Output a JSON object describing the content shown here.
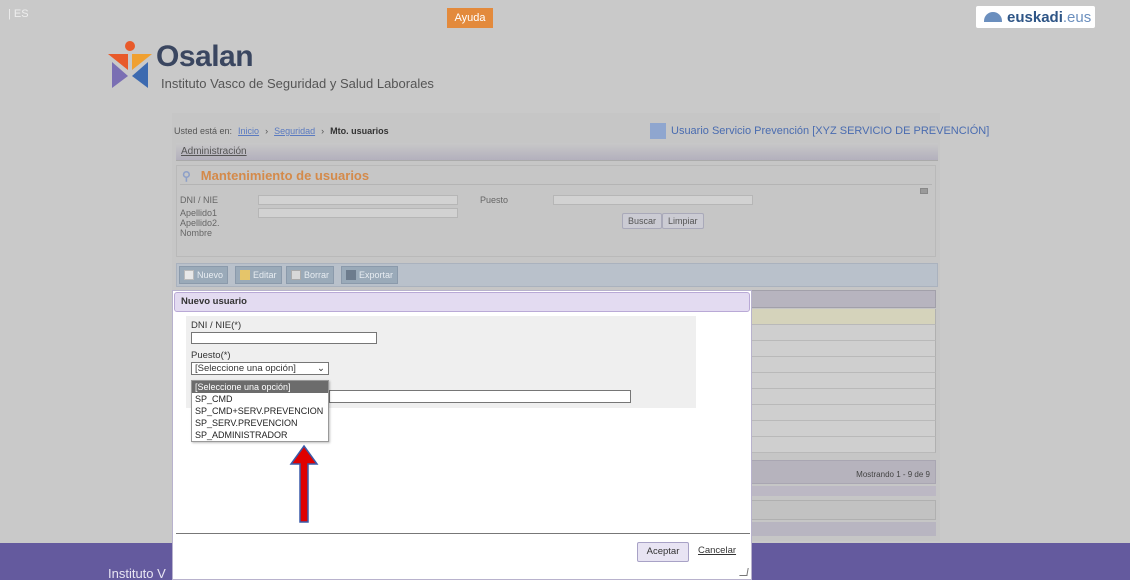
{
  "topbar": {
    "lang": "| ES",
    "help_label": "Ayuda",
    "euskadi_logo": {
      "brand": "euskadi",
      "suffix": ".eus"
    }
  },
  "header": {
    "name": "Osalan",
    "subtitle": "Instituto Vasco de Seguridad y Salud Laborales"
  },
  "breadcrumb": {
    "prefix": "Usted está en:",
    "items": [
      "Inicio",
      "Seguridad"
    ],
    "current": "Mto. usuarios"
  },
  "user": {
    "label": "Usuario Servicio Prevención [XYZ SERVICIO DE PREVENCIÓN]"
  },
  "admin": {
    "label": "Administración"
  },
  "maintenance": {
    "title": "Mantenimiento de usuarios",
    "fields": {
      "dni": "DNI / NIE",
      "apellido1": "Apellido1",
      "apellido2": "Apellido2.",
      "nombre": "Nombre",
      "puesto": "Puesto"
    },
    "search_label": "Buscar",
    "clear_label": "Limpiar"
  },
  "toolbar": {
    "new_label": "Nuevo",
    "edit_label": "Editar",
    "delete_label": "Borrar",
    "export_label": "Exportar"
  },
  "grid": {
    "footer_text": "Mostrando 1 - 9 de 9"
  },
  "modal": {
    "title": "Nuevo usuario",
    "dni_label": "DNI / NIE(*)",
    "puesto_label": "Puesto(*)",
    "puesto_selected": "[Seleccione una opción]",
    "options": [
      "[Seleccione una opción]",
      "SP_CMD",
      "SP_CMD+SERV.PREVENCION",
      "SP_SERV.PREVENCION",
      "SP_ADMINISTRADOR"
    ],
    "accept_label": "Aceptar",
    "cancel_label": "Cancelar"
  },
  "footer": {
    "text": "Instituto V"
  },
  "colors": {
    "accent_orange": "#e38a3c",
    "footer_purple": "#645a9e",
    "annotation_arrow": "#e00000"
  }
}
